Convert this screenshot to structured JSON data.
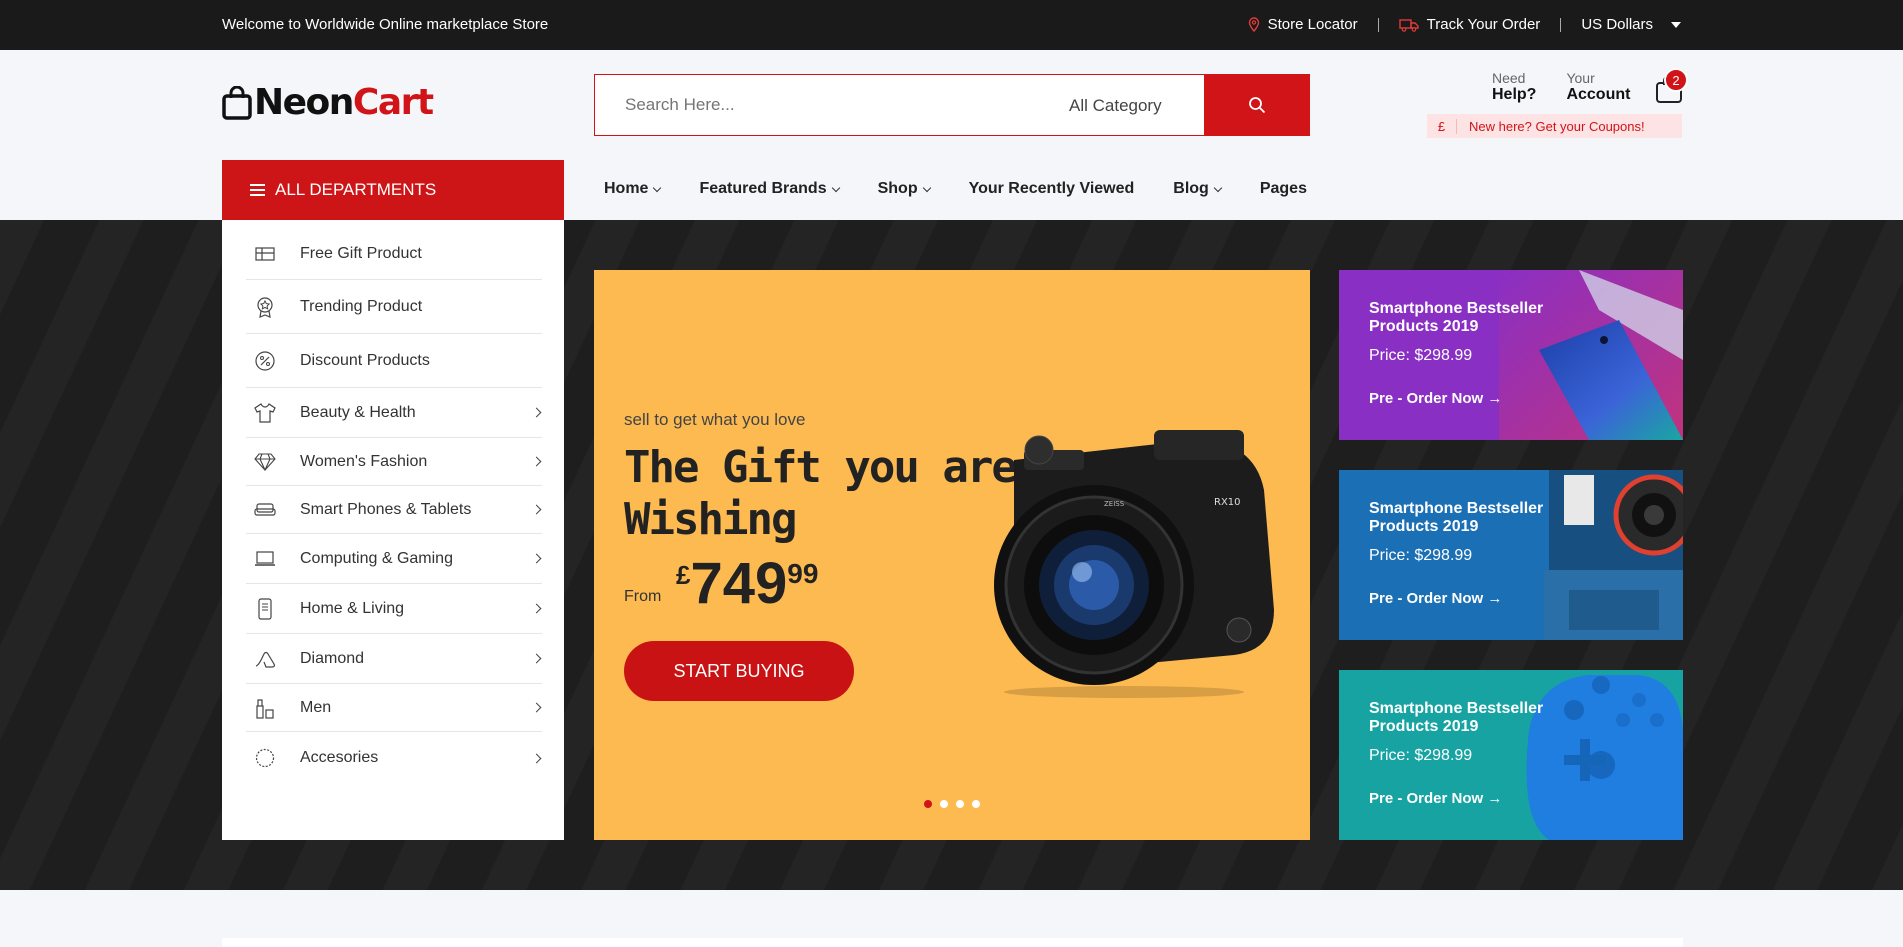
{
  "topbar": {
    "welcome": "Welcome to Worldwide Online marketplace Store",
    "store_locator": "Store Locator",
    "track_order": "Track Your Order",
    "currency": "US Dollars"
  },
  "logo": {
    "part1": "Neon",
    "part2": "Cart"
  },
  "search": {
    "placeholder": "Search Here...",
    "category": "All Category"
  },
  "account": {
    "help_label": "Need",
    "help_value": "Help?",
    "account_label": "Your",
    "account_value": "Account",
    "cart_count": "2"
  },
  "coupon": {
    "symbol": "£",
    "text": "New here? Get your Coupons!"
  },
  "departments": {
    "title": "ALL DEPARTMENTS"
  },
  "nav": [
    "Home",
    "Featured Brands",
    "Shop",
    "Your Recently Viewed",
    "Blog",
    "Pages"
  ],
  "sidebar": {
    "items": [
      {
        "label": "Free Gift Product",
        "icon": "gift-card-icon",
        "arrow": false
      },
      {
        "label": "Trending Product",
        "icon": "badge-star-icon",
        "arrow": false
      },
      {
        "label": "Discount Products",
        "icon": "percent-badge-icon",
        "arrow": false
      },
      {
        "label": "Beauty & Health",
        "icon": "shirt-icon",
        "arrow": true
      },
      {
        "label": "Women's Fashion",
        "icon": "diamond-icon",
        "arrow": true
      },
      {
        "label": "Smart Phones & Tablets",
        "icon": "sofa-icon",
        "arrow": true
      },
      {
        "label": "Computing & Gaming",
        "icon": "laptop-icon",
        "arrow": true
      },
      {
        "label": "Home & Living",
        "icon": "phone-icon",
        "arrow": true
      },
      {
        "label": "Diamond",
        "icon": "heel-icon",
        "arrow": true
      },
      {
        "label": "Men",
        "icon": "cosmetics-icon",
        "arrow": true
      },
      {
        "label": "Accesories",
        "icon": "necklace-icon",
        "arrow": true
      }
    ]
  },
  "banner": {
    "subtitle": "sell to get what you love",
    "title_line1": "The Gift you are",
    "title_line2": "Wishing",
    "from": "From",
    "currency": "£",
    "price_main": "749",
    "price_cents": "99",
    "button": "START BUYING"
  },
  "promos": [
    {
      "title": "Smartphone Bestseller Products 2019",
      "price": "Price: $298.99",
      "link": "Pre - Order Now →",
      "color": "#8a2fc4"
    },
    {
      "title": "Smartphone Bestseller Products 2019",
      "price": "Price: $298.99",
      "link": "Pre - Order Now →",
      "color": "#1b6fb5"
    },
    {
      "title": "Smartphone Bestseller Products 2019",
      "price": "Price: $298.99",
      "link": "Pre - Order Now →",
      "color": "#18a3a3"
    }
  ],
  "colors": {
    "accent": "#d01418",
    "topbar": "#1a1a1a",
    "banner": "#fdba51"
  }
}
